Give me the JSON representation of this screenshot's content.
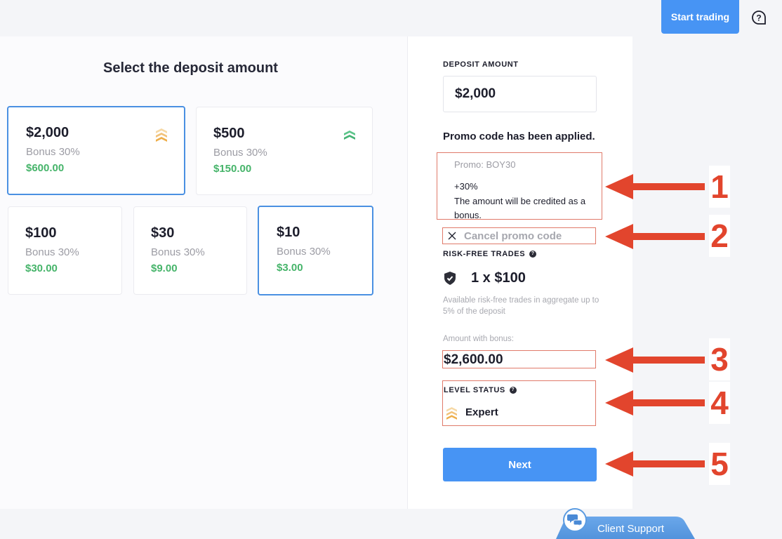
{
  "topbar": {
    "start_trading_label": "Start trading",
    "help_icon": "help-bubble-icon"
  },
  "left": {
    "title": "Select the deposit amount",
    "cards": [
      {
        "amount": "$2,000",
        "bonus": "Bonus 30%",
        "bonus_value": "$600.00",
        "selected": true,
        "level_icon": "chevron-triple-gold-icon"
      },
      {
        "amount": "$500",
        "bonus": "Bonus 30%",
        "bonus_value": "$150.00",
        "selected": false,
        "level_icon": "chevron-double-green-icon"
      },
      {
        "amount": "$100",
        "bonus": "Bonus 30%",
        "bonus_value": "$30.00",
        "selected": false
      },
      {
        "amount": "$30",
        "bonus": "Bonus 30%",
        "bonus_value": "$9.00",
        "selected": false
      },
      {
        "amount": "$10",
        "bonus": "Bonus 30%",
        "bonus_value": "$3.00",
        "selected": false
      }
    ]
  },
  "right": {
    "deposit_label": "DEPOSIT AMOUNT",
    "deposit_value": "$2,000",
    "promo_applied": "Promo code has been applied.",
    "promo_code": "Promo: BOY30",
    "promo_percent": "+30%",
    "promo_note": "The amount will be credited as a bonus.",
    "cancel_promo": "Cancel promo code",
    "risk_free_label": "RISK-FREE TRADES",
    "risk_free_value": "1 x $100",
    "risk_free_note": "Available risk-free trades in aggregate up to 5% of the deposit",
    "amount_with_bonus_label": "Amount with bonus:",
    "amount_with_bonus_value": "$2,600.00",
    "level_status_label": "LEVEL STATUS",
    "level_status_value": "Expert",
    "next_label": "Next",
    "help_glyph": "?"
  },
  "annotations": [
    "1",
    "2",
    "3",
    "4",
    "5"
  ],
  "support": {
    "label": "Client Support"
  },
  "colors": {
    "accent_blue": "#4794f4",
    "bonus_green": "#46b46a",
    "annotation_red": "#e2452d",
    "selected_border": "#4a90e2",
    "gold_level": "#f0b64a",
    "green_level": "#4fbf7d"
  }
}
